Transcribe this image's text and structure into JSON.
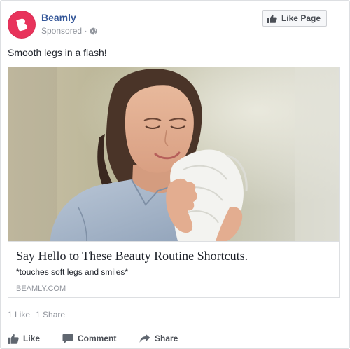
{
  "post": {
    "page_name": "Beamly",
    "sponsored_label": "Sponsored",
    "separator": "·",
    "audience_icon": "globe-icon",
    "like_page_label": "Like Page",
    "text": "Smooth legs in a flash!"
  },
  "link_preview": {
    "title": "Say Hello to These Beauty Routine Shortcuts.",
    "description": "*touches soft legs and smiles*",
    "domain": "BEAMLY.COM",
    "image_description_icon": "woman-with-towel-photo"
  },
  "engagement": {
    "likes": "1 Like",
    "shares": "1 Share"
  },
  "actions": {
    "like": "Like",
    "comment": "Comment",
    "share": "Share"
  },
  "colors": {
    "brand": "#e8335b",
    "link": "#365899",
    "muted": "#90949c"
  }
}
